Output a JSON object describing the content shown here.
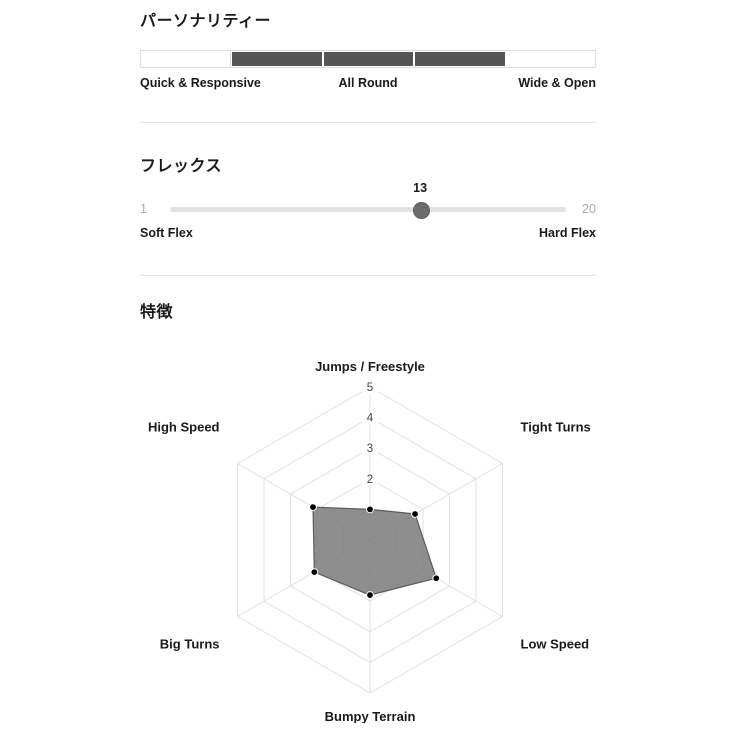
{
  "personality": {
    "title": "パーソナリティー",
    "segments": [
      {
        "filled": false
      },
      {
        "filled": true
      },
      {
        "filled": true
      },
      {
        "filled": true
      },
      {
        "filled": false
      }
    ],
    "label_left": "Quick & Responsive",
    "label_mid": "All Round",
    "label_right": "Wide & Open",
    "fill_color": "#555555",
    "track_color": "#ffffff",
    "border_color": "#dddddd"
  },
  "flex": {
    "title": "フレックス",
    "value": "13",
    "min": "1",
    "max": "20",
    "min_num": 1,
    "max_num": 20,
    "value_num": 13,
    "label_left": "Soft Flex",
    "label_right": "Hard Flex",
    "track_color": "#e2e2e2",
    "thumb_color": "#6b6b6b"
  },
  "features": {
    "title": "特徴"
  },
  "chart_data": {
    "type": "radar",
    "title": "特徴",
    "categories": [
      "Jumps / Freestyle",
      "Tight Turns",
      "Low Speed",
      "Bumpy Terrain",
      "Big Turns",
      "High Speed"
    ],
    "values": [
      1.0,
      1.7,
      2.5,
      1.8,
      2.1,
      2.15
    ],
    "series": [
      {
        "name": "特徴",
        "values": [
          1.0,
          1.7,
          2.5,
          1.8,
          2.1,
          2.15
        ]
      }
    ],
    "tick_labels": [
      "2",
      "3",
      "4",
      "5"
    ],
    "tick_values": [
      2,
      3,
      4,
      5
    ],
    "rmin": 0,
    "rmax": 5,
    "rings": 5,
    "grid": true,
    "legend": "none",
    "fill_color": "#7a7a7a",
    "stroke_color": "#5c5c5c",
    "point_color": "#000000",
    "grid_color": "#e0e0e0"
  },
  "dividers": {
    "color": "#e4e4e4"
  }
}
